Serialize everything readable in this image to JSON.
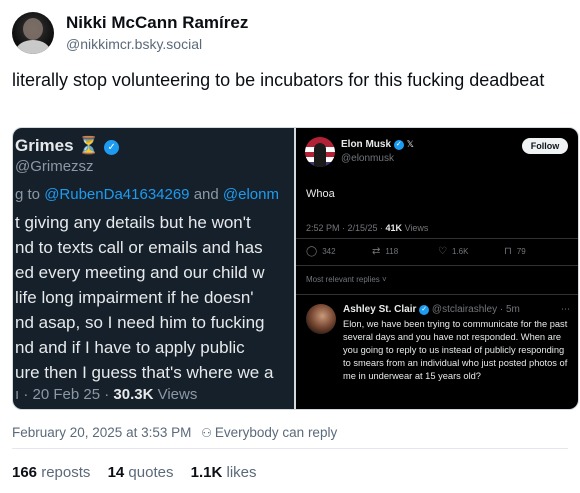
{
  "author": {
    "display_name": "Nikki McCann Ramírez",
    "handle": "@nikkimcr.bsky.social"
  },
  "post": {
    "text": "literally stop volunteering to be incubators for this fucking deadbeat"
  },
  "embed_left": {
    "name": "Grimes",
    "hourglass": "⏳",
    "handle": "@Grimezsz",
    "reply_prefix": "g to ",
    "mention_1": "@RubenDa41634269",
    "reply_and": " and ",
    "mention_2": "@elonm",
    "lines": [
      "t giving any details but he won't",
      "nd to texts call or emails and has",
      "ed every meeting and our child w",
      " life long impairment if he doesn'",
      "nd asap, so I need him to fucking",
      "nd and if I have to apply public",
      "ure then I guess that's where we a"
    ],
    "meta_date": "ı · 20 Feb 25 · ",
    "views_count": "30.3K",
    "views_label": " Views"
  },
  "embed_right": {
    "name": "Elon Musk",
    "handle": "@elonmusk",
    "follow_label": "Follow",
    "text": "Whoa",
    "meta_time": "2:52 PM · 2/15/25 · ",
    "views_count": "41K",
    "views_label": " Views",
    "actions": [
      {
        "icon": "reply-icon",
        "glyph": "◯",
        "count": "342"
      },
      {
        "icon": "repost-icon",
        "glyph": "⇄",
        "count": "118"
      },
      {
        "icon": "like-icon",
        "glyph": "♡",
        "count": "1.6K"
      },
      {
        "icon": "bookmark-icon",
        "glyph": "⊓",
        "count": "79"
      }
    ],
    "relevant_label": "Most relevant replies ˅",
    "reply": {
      "name": "Ashley St. Clair",
      "handle_time": "@stclairashley · 5m",
      "text": "Elon, we have been trying to communicate for the past several days and you have not responded. When are you going to reply to us instead of publicly responding to smears from an individual who just posted photos of me in underwear at 15 years old?"
    }
  },
  "timestamp": "February 20, 2025 at 3:53 PM",
  "reply_setting": "Everybody can reply",
  "stats": {
    "reposts_count": "166",
    "reposts_label": " reposts",
    "quotes_count": "14",
    "quotes_label": " quotes",
    "likes_count": "1.1K",
    "likes_label": " likes"
  }
}
